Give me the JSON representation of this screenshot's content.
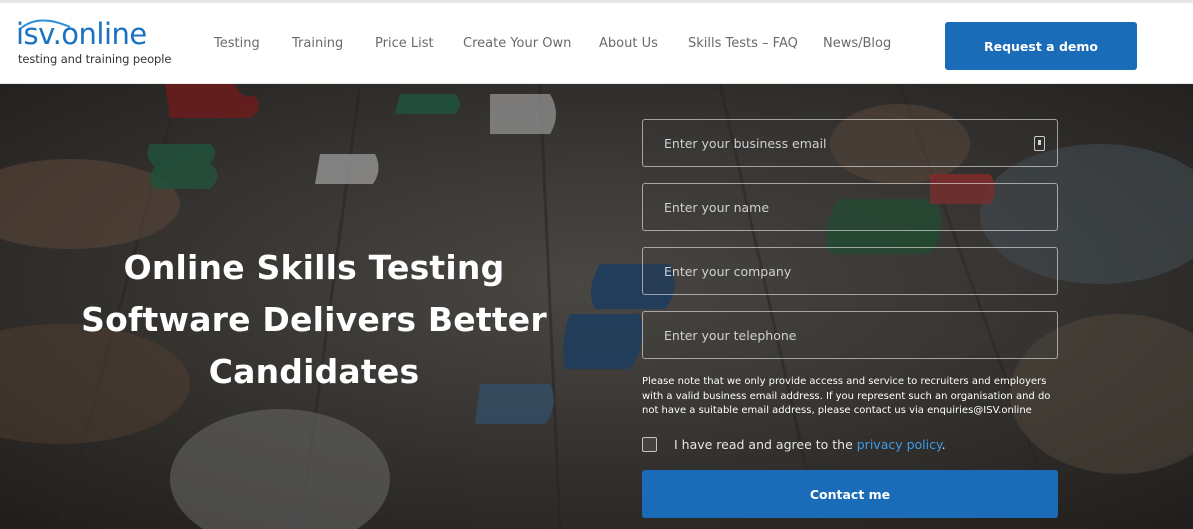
{
  "brand": {
    "name": "isv.online",
    "tagline": "testing and training people",
    "color": "#1a72c0"
  },
  "nav": {
    "items": [
      {
        "label": "Testing"
      },
      {
        "label": "Training"
      },
      {
        "label": "Price List"
      },
      {
        "label": "Create Your Own"
      },
      {
        "label": "About Us"
      },
      {
        "label": "Skills Tests – FAQ"
      },
      {
        "label": "News/Blog"
      }
    ],
    "cta_label": "Request a demo"
  },
  "hero": {
    "title_lines": [
      "Online Skills Testing",
      "Software Delivers Better",
      "Candidates"
    ]
  },
  "form": {
    "email_placeholder": "Enter your business email",
    "name_placeholder": "Enter your name",
    "company_placeholder": "Enter your company",
    "telephone_placeholder": "Enter your telephone",
    "note": "Please note that we only provide access and service to recruiters and employers with a valid business email address. If you represent such an organisation and do not have a suitable email address, please contact us via enquiries@ISV.online",
    "agree_text": "I have read and agree to the ",
    "agree_link": "privacy policy",
    "agree_suffix": ".",
    "submit_label": "Contact me"
  },
  "colors": {
    "primary": "#1a6cb8",
    "link": "#3d9be9"
  }
}
